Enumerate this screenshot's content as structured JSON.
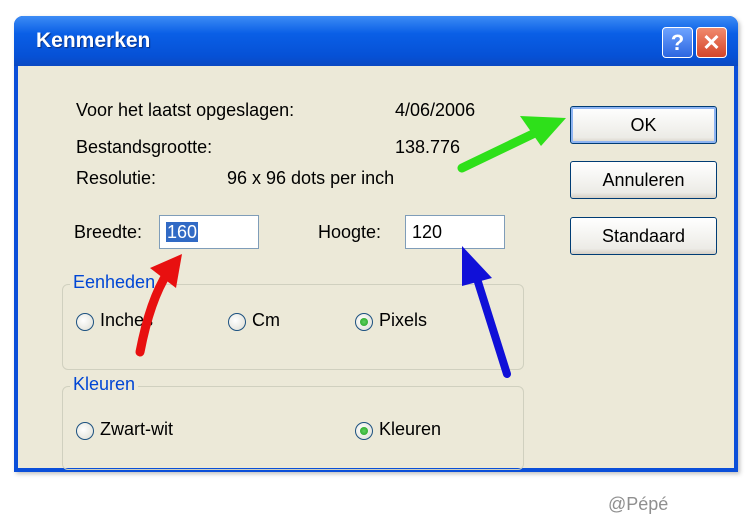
{
  "window": {
    "title": "Kenmerken",
    "help_glyph": "?",
    "close_glyph": "✕"
  },
  "info": {
    "saved_label": "Voor het laatst opgeslagen:",
    "saved_value": "4/06/2006",
    "size_label": "Bestandsgrootte:",
    "size_value": "138.776",
    "resolution_label": "Resolutie:",
    "resolution_value": "96 x 96 dots per inch"
  },
  "buttons": {
    "ok": "OK",
    "cancel": "Annuleren",
    "default": "Standaard"
  },
  "fields": {
    "width_label": "Breedte:",
    "width_value": "160",
    "height_label": "Hoogte:",
    "height_value": "120"
  },
  "units": {
    "legend": "Eenheden",
    "options": [
      "Inches",
      "Cm",
      "Pixels"
    ],
    "selected": "Pixels"
  },
  "colors_group": {
    "legend": "Kleuren",
    "options": [
      "Zwart-wit",
      "Kleuren"
    ],
    "selected": "Kleuren"
  },
  "watermark": "@Pépé",
  "annotation_arrows": {
    "green": "#2ee01a",
    "red": "#e81010",
    "blue": "#1010d8"
  },
  "icons": [
    "help-icon",
    "close-icon",
    "arrow-green",
    "arrow-red",
    "arrow-blue"
  ]
}
